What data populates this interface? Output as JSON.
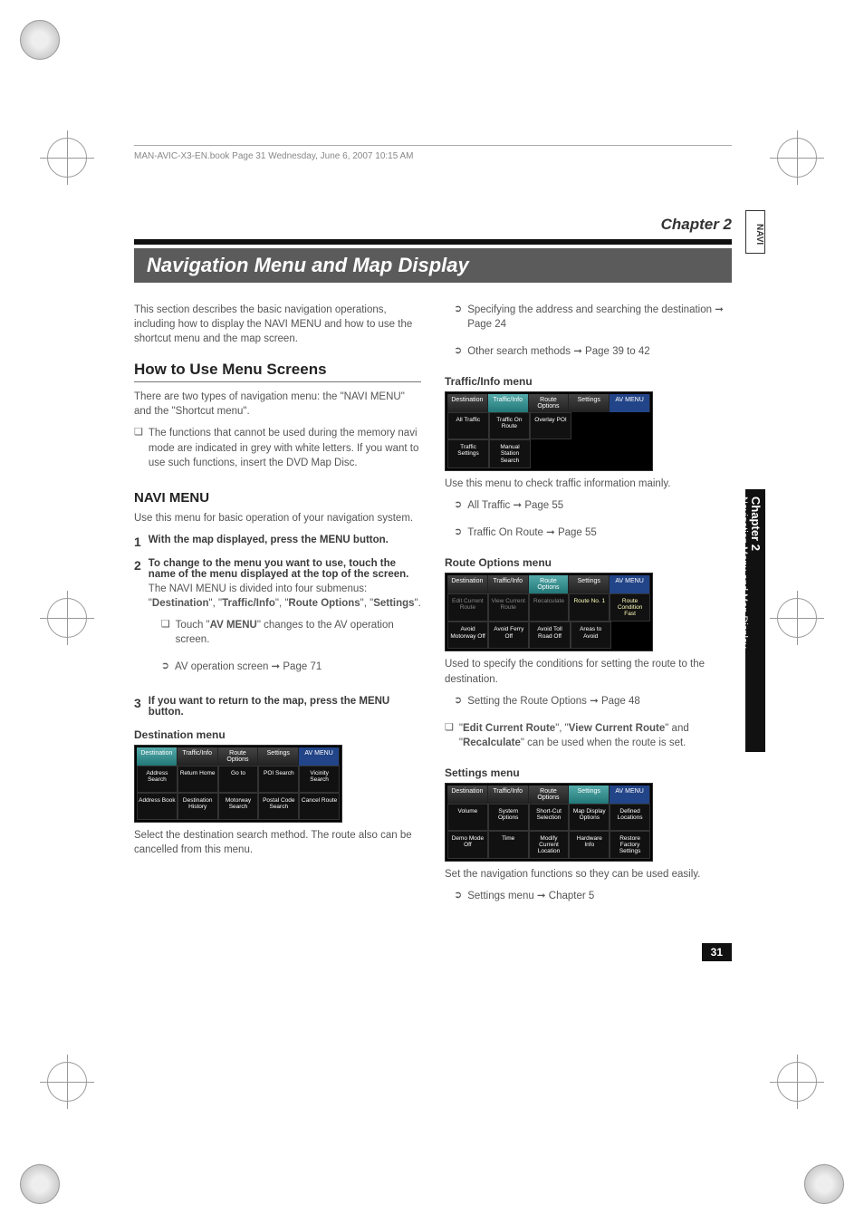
{
  "running_header": "MAN-AVIC-X3-EN.book  Page 31  Wednesday, June 6, 2007  10:15 AM",
  "chapter_label": "Chapter 2",
  "page_title": "Navigation Menu and Map Display",
  "side_tab_top": "NAVI",
  "side_tab_chapter": "Chapter 2",
  "side_tab_title": "Navigation Menu and Map Display",
  "page_number": "31",
  "intro": "This section describes the basic navigation operations, including how to display the NAVI MENU and how to use the shortcut menu and the map screen.",
  "h2_howto": "How to Use Menu Screens",
  "howto_p1": "There are two types of navigation menu: the \"NAVI MENU\" and the \"Shortcut menu\".",
  "howto_bullet": "The functions that cannot be used during the memory navi mode are indicated in grey with white letters. If you want to use such functions, insert the DVD Map Disc.",
  "h3_navimenu": "NAVI MENU",
  "navimenu_p": "Use this menu for basic operation of your navigation system.",
  "step1_title_pre": "With the map displayed, press the ",
  "step1_title_key": "MENU",
  "step1_title_post": " button.",
  "step2_title": "To change to the menu you want to use, touch the name of the menu displayed at the top of the screen.",
  "step2_p_pre": "The NAVI MENU is divided into four submenus: \"",
  "step2_m1": "Destination",
  "step2_m2": "Traffic/Info",
  "step2_m3": "Route Options",
  "step2_m4": "Settings",
  "step2_p_post": "\".",
  "step2_sub_pre": "Touch \"",
  "step2_sub_key": "AV MENU",
  "step2_sub_post": "\" changes to the AV operation screen.",
  "step2_ref": "AV operation screen ➞ Page 71",
  "step3_title_pre": "If you want to return to the map, press the ",
  "step3_title_key": "MENU",
  "step3_title_post": " button.",
  "dest_caption": "Destination menu",
  "dest_tabs": [
    "Destination",
    "Traffic/Info",
    "Route Options",
    "Settings",
    "AV MENU"
  ],
  "dest_cells": [
    [
      "Address Search",
      "Return Home",
      "Go to",
      "POI Search",
      "Vicinity Search"
    ],
    [
      "Address Book",
      "Destination History",
      "Motorway Search",
      "Postal Code Search",
      "Cancel Route"
    ]
  ],
  "dest_p": "Select the destination search method. The route also can be cancelled from this menu.",
  "right_ref1": "Specifying the address and searching the destination ➞ Page 24",
  "right_ref2": "Other search methods ➞ Page 39 to 42",
  "traffic_caption": "Traffic/Info menu",
  "traffic_tabs": [
    "Destination",
    "Traffic/Info",
    "Route Options",
    "Settings",
    "AV MENU"
  ],
  "traffic_cells": [
    [
      "All Traffic",
      "Traffic On Route",
      "Overlay POI",
      "",
      ""
    ],
    [
      "Traffic Settings",
      "Manual Station Search",
      "",
      "",
      ""
    ]
  ],
  "traffic_p": "Use this menu to check traffic information mainly.",
  "traffic_ref1": "All Traffic ➞ Page 55",
  "traffic_ref2": "Traffic On Route ➞ Page 55",
  "route_caption": "Route Options menu",
  "route_tabs": [
    "Destination",
    "Traffic/Info",
    "Route Options",
    "Settings",
    "AV MENU"
  ],
  "route_cells": [
    [
      "Edit Current Route",
      "View Current Route",
      "Recalculate",
      "Route No. 1",
      "Route Condition Fast"
    ],
    [
      "Avoid Motorway Off",
      "Avoid Ferry Off",
      "Avoid Toll Road Off",
      "Areas to Avoid",
      ""
    ]
  ],
  "route_p": "Used to specify the conditions for setting the route to the destination.",
  "route_ref1": "Setting the Route Options ➞ Page 48",
  "route_sq_pre": "\"",
  "route_sq_k1": "Edit Current Route",
  "route_sq_mid1": "\", \"",
  "route_sq_k2": "View Current Route",
  "route_sq_mid2": "\" and \"",
  "route_sq_k3": "Recalculate",
  "route_sq_post": "\" can be used when the route is set.",
  "settings_caption": "Settings menu",
  "settings_tabs": [
    "Destination",
    "Traffic/Info",
    "Route Options",
    "Settings",
    "AV MENU"
  ],
  "settings_cells": [
    [
      "Volume",
      "System Options",
      "Short-Cut Selection",
      "Map Display Options",
      "Defined Locations"
    ],
    [
      "Demo Mode Off",
      "Time",
      "Modify Current Location",
      "Hardware Info",
      "Restore Factory Settings"
    ]
  ],
  "settings_p": "Set the navigation functions so they can be used easily.",
  "settings_ref": "Settings menu ➞ Chapter 5"
}
